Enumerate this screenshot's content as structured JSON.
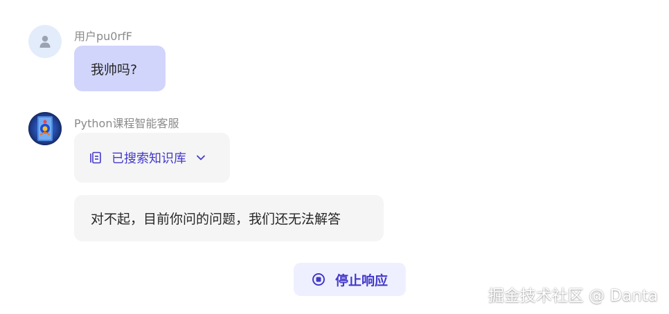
{
  "messages": [
    {
      "role": "user",
      "sender": "用户pu0rfF",
      "text": "我帅吗?"
    },
    {
      "role": "assistant",
      "sender": "Python课程智能客服",
      "kb_status": "已搜索知识库",
      "text": "对不起，目前你问的问题，我们还无法解答"
    }
  ],
  "actions": {
    "stop_label": "停止响应"
  },
  "watermark": "掘金技术社区 @ Danta",
  "icons": {
    "user_avatar": "user-icon",
    "bot_avatar": "bot-avatar-image",
    "kb": "document-icon",
    "expand": "chevron-down-icon",
    "stop": "stop-circle-icon"
  },
  "colors": {
    "accent": "#4338ca",
    "user_bubble": "#d1d5fb",
    "bot_bubble": "#f5f5f5",
    "stop_bg": "#eef0ff"
  }
}
